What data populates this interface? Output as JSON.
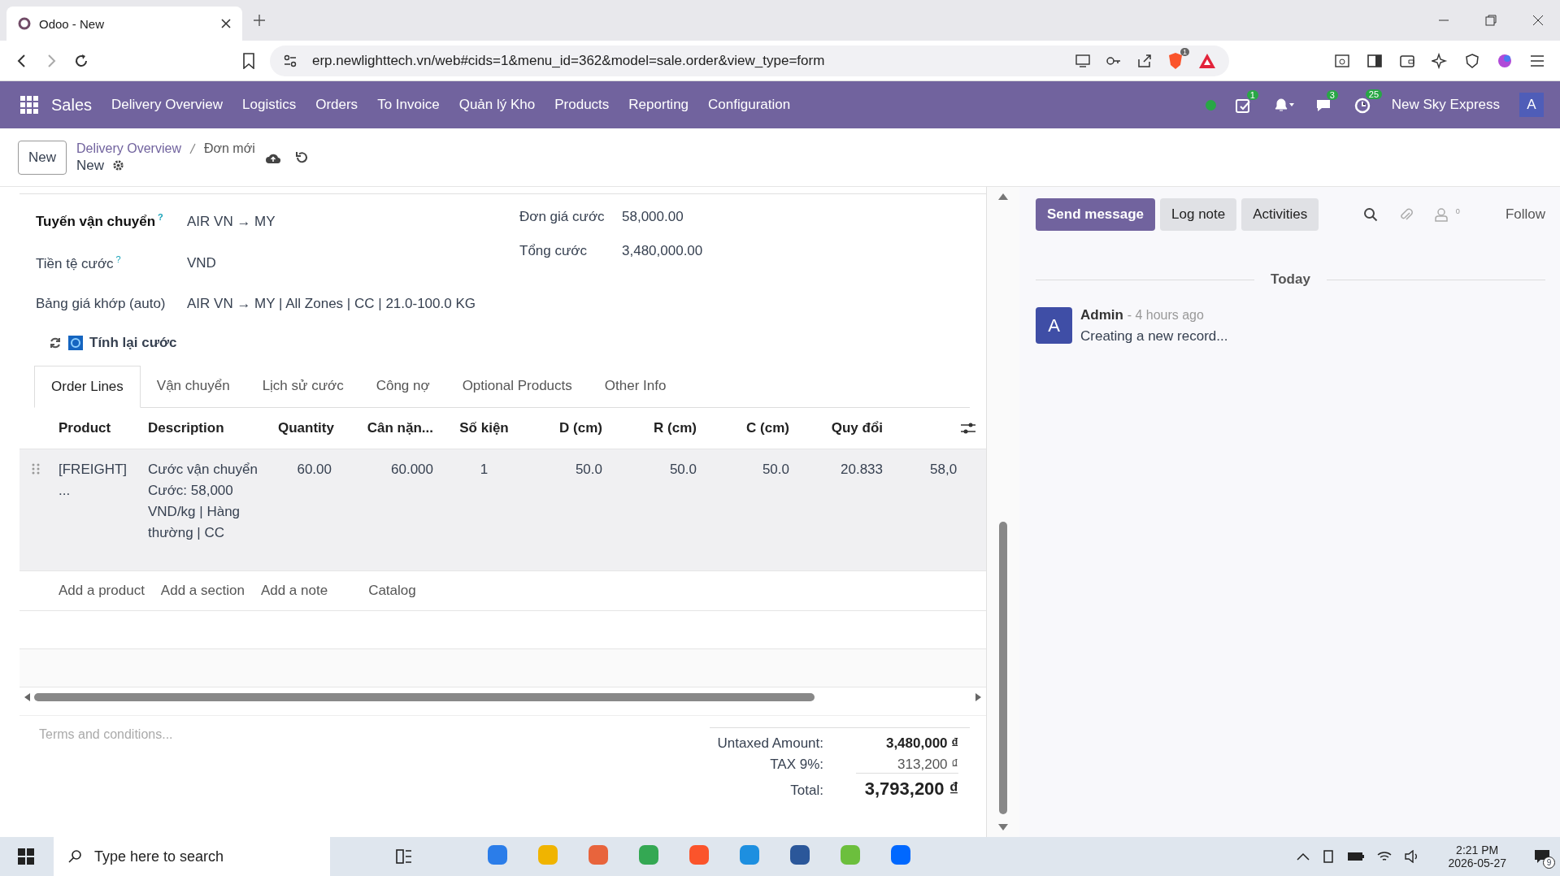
{
  "browser": {
    "tab_title": "Odoo - New",
    "url": "erp.newlighttech.vn/web#cids=1&menu_id=362&model=sale.order&view_type=form",
    "shield_count": "1"
  },
  "navbar": {
    "app": "Sales",
    "menu": [
      "Delivery Overview",
      "Logistics",
      "Orders",
      "To Invoice",
      "Quản lý Kho",
      "Products",
      "Reporting",
      "Configuration"
    ],
    "activity_count": "1",
    "message_count": "3",
    "timer_count": "25",
    "company": "New Sky Express",
    "avatar": "A"
  },
  "control_panel": {
    "new_button": "New",
    "breadcrumb": [
      "Delivery Overview",
      "Đơn mới"
    ],
    "record": "New"
  },
  "form": {
    "left_fields": [
      {
        "label": "Tuyến vận chuyển",
        "required": true,
        "help": "?",
        "value": "AIR VN → MY"
      },
      {
        "label": "Tiền tệ cước",
        "required": false,
        "help": "?",
        "value": "VND"
      },
      {
        "label": "Bảng giá khớp (auto)",
        "required": false,
        "value": "AIR VN → MY | All Zones | CC | 21.0-100.0 KG"
      }
    ],
    "right_fields": [
      {
        "label": "Đơn giá cước",
        "value": "58,000.00"
      },
      {
        "label": "Tổng cước",
        "value": "3,480,000.00"
      }
    ],
    "action_button": "Tính lại cước",
    "tabs": [
      {
        "label": "Order Lines",
        "selected": true
      },
      {
        "label": "Vận chuyển",
        "selected": false
      },
      {
        "label": "Lịch sử cước",
        "selected": false
      },
      {
        "label": "Công nợ",
        "selected": false
      },
      {
        "label": "Optional Products",
        "selected": false
      },
      {
        "label": "Other Info",
        "selected": false
      }
    ],
    "table": {
      "columns": [
        "Product",
        "Description",
        "Quantity",
        "Cân nặn...",
        "Số kiện",
        "D (cm)",
        "R (cm)",
        "C (cm)",
        "Quy đổi"
      ],
      "rows": [
        [
          "[FREIGHT] ...",
          "Cước vận chuyển Cước: 58,000 VND/kg | Hàng thường | CC",
          "60.00",
          "60.000",
          "1",
          "50.0",
          "50.0",
          "50.0",
          "20.833",
          "58,0"
        ]
      ],
      "add_links": [
        "Add a product",
        "Add a section",
        "Add a note",
        "Catalog"
      ]
    },
    "terms": {
      "placeholder": "Terms and conditions..."
    },
    "totals": [
      {
        "label": "Untaxed Amount:",
        "value": "3,480,000 ₫",
        "kind": "subtotal"
      },
      {
        "label": "TAX 9%:",
        "value": "313,200 ₫",
        "kind": "tax"
      },
      {
        "label": "Total:",
        "value": "3,793,200 ₫",
        "kind": "total"
      }
    ]
  },
  "chatter": {
    "buttons": [
      {
        "label": "Send message",
        "selected": true
      },
      {
        "label": "Log note",
        "selected": false
      },
      {
        "label": "Activities",
        "selected": false
      }
    ],
    "follower_count": "0",
    "follow": "Follow",
    "date_separator": "Today",
    "messages": [
      {
        "avatar": "A",
        "author": "Admin",
        "time": "- 4 hours ago",
        "body": "Creating a new record..."
      }
    ]
  },
  "taskbar": {
    "search_placeholder": "Type here to search",
    "time": "2:21 PM",
    "date": "2026-05-27",
    "notification_count": "9"
  }
}
